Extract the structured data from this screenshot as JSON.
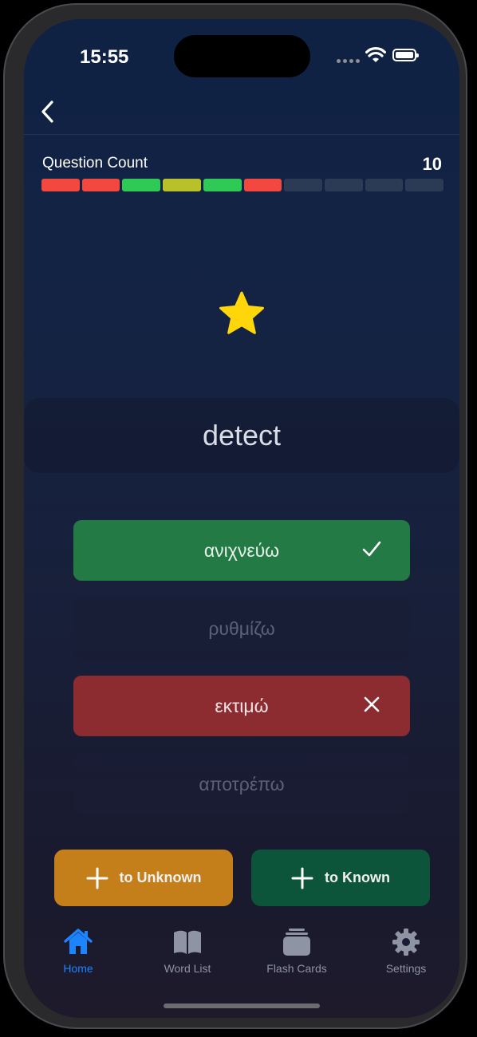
{
  "status_bar": {
    "time": "15:55"
  },
  "quiz": {
    "question_count_label": "Question Count",
    "question_count_value": "10",
    "progress": [
      "wrong",
      "wrong",
      "correct",
      "partial",
      "correct",
      "wrong",
      "pending",
      "pending",
      "pending",
      "pending"
    ],
    "word": "detect",
    "answers": [
      {
        "text": "ανιχνεύω",
        "state": "correct"
      },
      {
        "text": "ρυθμίζω",
        "state": "neutral"
      },
      {
        "text": "εκτιμώ",
        "state": "wrong"
      },
      {
        "text": "αποτρέπω",
        "state": "neutral"
      }
    ]
  },
  "actions": {
    "to_unknown_label": "to Unknown",
    "to_known_label": "to Known"
  },
  "tabs": [
    {
      "label": "Home",
      "icon": "house-icon",
      "active": true
    },
    {
      "label": "Word List",
      "icon": "book-icon",
      "active": false
    },
    {
      "label": "Flash Cards",
      "icon": "cards-stack-icon",
      "active": false
    },
    {
      "label": "Settings",
      "icon": "gear-icon",
      "active": false
    }
  ],
  "colors": {
    "wrong": "#f2483f",
    "correct": "#2fc955",
    "partial": "#b8c12a",
    "pending": "#2c3b55",
    "accent": "#1d84ff",
    "star": "#ffd60a",
    "correct_answer_bg": "#237a45",
    "wrong_answer_bg": "#8c2b30",
    "to_unknown_bg": "#c47f1a",
    "to_known_bg": "#0d553a"
  }
}
